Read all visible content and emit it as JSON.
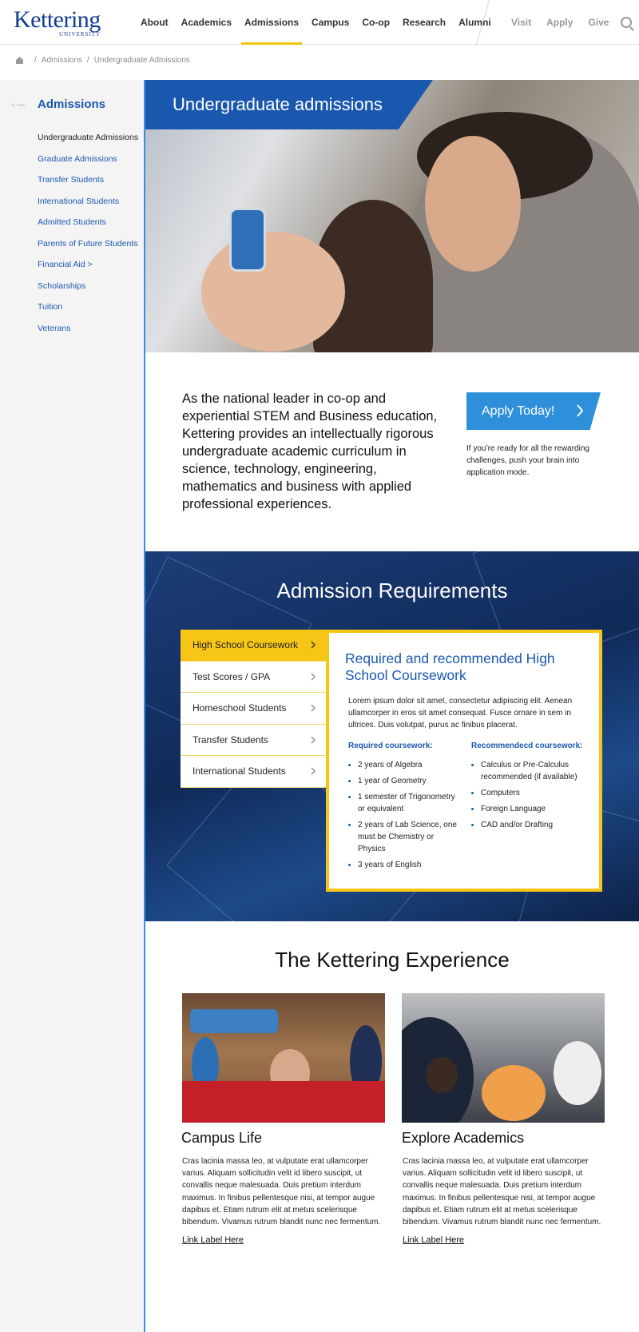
{
  "header": {
    "logo_main": "Kettering",
    "logo_sub": "UNIVERSITY",
    "nav": [
      "About",
      "Academics",
      "Admissions",
      "Campus",
      "Co-op",
      "Research",
      "Alumni"
    ],
    "nav_active": "Admissions",
    "utility": [
      "Visit",
      "Apply",
      "Give"
    ],
    "icons": {
      "search": "search-icon",
      "home": "home-icon"
    }
  },
  "breadcrumb": [
    "Admissions",
    "Undergraduate Admissions"
  ],
  "sidebar": {
    "back": "‹ —",
    "title": "Admissions",
    "items": [
      "Undergraduate Admissions",
      "Graduate Admissions",
      "Transfer Students",
      "International Students",
      "Admitted Students",
      "Parents of Future Students",
      "Financial Aid >",
      "Scholarships",
      "Tuition",
      "Veterans"
    ],
    "current_index": 0
  },
  "hero": {
    "title": "Undergraduate admissions"
  },
  "intro": {
    "text": "As the national leader in co-op and experiential STEM and Business education, Kettering provides an intellectually rigorous undergraduate academic curriculum in science, technology, engineering, mathematics and business with applied professional experiences.",
    "apply_label": "Apply Today!",
    "apply_caption": "If you’re ready for all the rewarding challenges, push your brain into application mode."
  },
  "requirements": {
    "title": "Admission Requirements",
    "tabs": [
      "High School Coursework",
      "Test Scores / GPA",
      "Homeschool Students",
      "Transfer Students",
      "International Students"
    ],
    "active_tab": 0,
    "panel": {
      "heading": "Required and recommended High School Coursework",
      "body": "Lorem ipsum dolor sit amet, consectetur adipiscing elit. Aenean ullamcorper in eros sit amet consequat. Fusce ornare in sem in ultrices. Duis volutpat, purus ac finibus placerat.",
      "required_heading": "Required coursework:",
      "required": [
        "2 years of Algebra",
        "1 year of Geometry",
        "1 semester of Trigonometry or equivalent",
        "2 years of Lab Science, one must be Chemistry or Physics",
        "3 years of English"
      ],
      "recommended_heading": "Recommendecd coursework:",
      "recommended": [
        "Calculus or Pre-Calculus recommended (if available)",
        "Computers",
        "Foreign Language",
        "CAD and/or Drafting"
      ]
    }
  },
  "experience": {
    "title": "The Kettering Experience",
    "cards": [
      {
        "title": "Campus Life",
        "text": "Cras lacinia massa leo, at vulputate erat ullamcorper varius. Aliquam sollicitudin velit id libero suscipit, ut convallis neque malesuada. Duis pretium interdum maximus. In finibus pellentesque nisi, at tempor augue dapibus et. Etiam rutrum elit at metus scelerisque bibendum. Vivamus rutrum blandit nunc nec fermentum.",
        "link": "Link Label Here"
      },
      {
        "title": "Explore Academics",
        "text": "Cras lacinia massa leo, at vulputate erat ullamcorper varius. Aliquam sollicitudin velit id libero suscipit, ut convallis neque malesuada. Duis pretium interdum maximus. In finibus pellentesque nisi, at tempor augue dapibus et. Etiam rutrum elit at metus scelerisque bibendum. Vivamus rutrum blandit nunc nec fermentum.",
        "link": "Link Label Here"
      }
    ]
  },
  "colors": {
    "brand_blue": "#1a58b0",
    "accent_blue": "#2e8fdb",
    "yellow": "#f6c515"
  }
}
